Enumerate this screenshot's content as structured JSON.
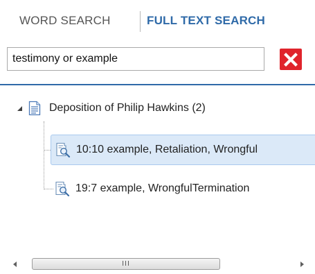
{
  "tabs": {
    "word_search": "WORD SEARCH",
    "full_text_search": "FULL TEXT SEARCH",
    "active": "full_text_search"
  },
  "search": {
    "value": "testimony or example",
    "clear_icon": "close-icon"
  },
  "tree": {
    "root": {
      "label": "Deposition of Philip Hawkins (2)",
      "icon": "document-icon",
      "expanded": true
    },
    "hits": [
      {
        "label": "10:10 example, Retaliation, Wrongful",
        "icon": "search-result-icon",
        "selected": true
      },
      {
        "label": "19:7 example, WrongfulTermination",
        "icon": "search-result-icon",
        "selected": false
      }
    ]
  },
  "scrollbar": {
    "grip": "III"
  },
  "colors": {
    "accent": "#2f6aa8",
    "clear_button": "#e0242c",
    "selection": "#dbe9f8"
  }
}
